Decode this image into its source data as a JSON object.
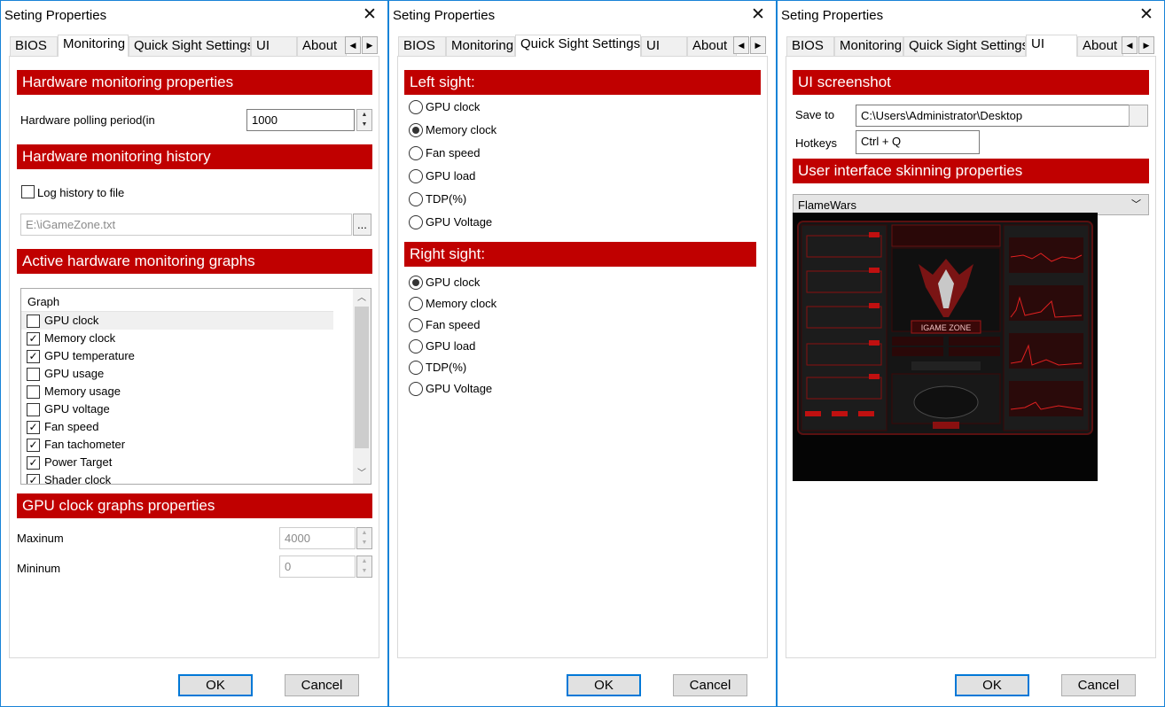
{
  "dialog_title": "Seting Properties",
  "close_glyph": "✕",
  "tabs": [
    "BIOS",
    "Monitoring",
    "Quick Sight Settings",
    "UI",
    "About"
  ],
  "tab_scroll": {
    "left": "◀",
    "right": "▶"
  },
  "buttons": {
    "ok": "OK",
    "cancel": "Cancel"
  },
  "monitoring": {
    "hw_props_title": "Hardware monitoring properties",
    "polling_label": "Hardware polling period(in",
    "polling_value": "1000",
    "history_title": "Hardware monitoring history",
    "log_history_label": "Log history to file",
    "log_history_checked": false,
    "log_path": "E:\\iGameZone.txt",
    "browse_label": "...",
    "graphs_title": "Active hardware monitoring graphs",
    "graph_header": "Graph",
    "graphs": [
      {
        "name": "GPU clock",
        "checked": false
      },
      {
        "name": "Memory clock",
        "checked": true
      },
      {
        "name": "GPU temperature",
        "checked": true
      },
      {
        "name": "GPU usage",
        "checked": false
      },
      {
        "name": "Memory usage",
        "checked": false
      },
      {
        "name": "GPU voltage",
        "checked": false
      },
      {
        "name": "Fan speed",
        "checked": true
      },
      {
        "name": "Fan tachometer",
        "checked": true
      },
      {
        "name": "Power Target",
        "checked": true
      },
      {
        "name": "Shader clock",
        "checked": true
      }
    ],
    "clock_props_title": "GPU clock graphs properties",
    "max_label": "Maxinum",
    "max_value": "4000",
    "min_label": "Mininum",
    "min_value": "0"
  },
  "quick_sight": {
    "left_title": "Left sight:",
    "left_options": [
      "GPU clock",
      "Memory clock",
      "Fan speed",
      "GPU load",
      "TDP(%)",
      "GPU Voltage"
    ],
    "left_selected": "Memory clock",
    "right_title": "Right sight:",
    "right_options": [
      "GPU clock",
      "Memory clock",
      "Fan speed",
      "GPU load",
      "TDP(%)",
      "GPU Voltage"
    ],
    "right_selected": "GPU clock"
  },
  "ui_tab": {
    "screenshot_title": "UI screenshot",
    "save_to_label": "Save to",
    "save_to_value": "C:\\Users\\Administrator\\Desktop",
    "hotkeys_label": "Hotkeys",
    "hotkeys_value": "Ctrl + Q",
    "skinning_title": "User interface skinning properties",
    "skin_selected": "FlameWars",
    "preview_logo": "IGAME ZONE"
  },
  "colors": {
    "section_header": "#c00000",
    "dialog_border": "#1883d7",
    "default_button_border": "#0078d7"
  }
}
